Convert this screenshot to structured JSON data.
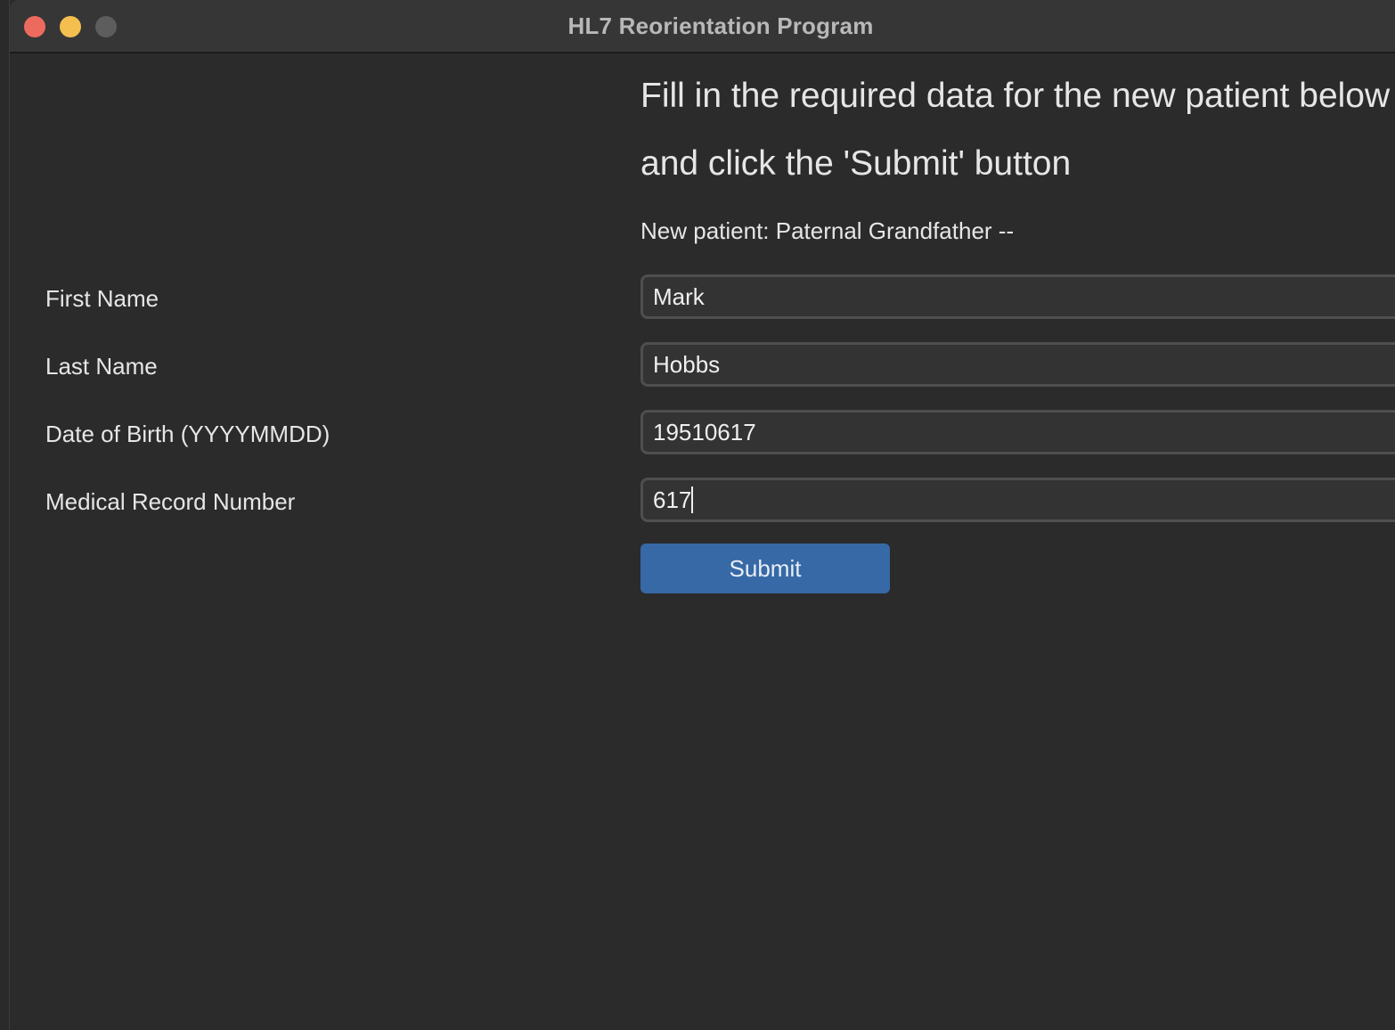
{
  "window": {
    "title": "HL7 Reorientation Program"
  },
  "instructions": {
    "line1": "Fill in the required data for the new patient below",
    "line2": "and click the 'Submit' button"
  },
  "patient": {
    "subtitle": "New patient: Paternal Grandfather --"
  },
  "form": {
    "first_name": {
      "label": "First Name",
      "value": "Mark"
    },
    "last_name": {
      "label": "Last Name",
      "value": "Hobbs"
    },
    "dob": {
      "label": "Date of Birth (YYYYMMDD)",
      "value": "19510617"
    },
    "mrn": {
      "label": "Medical Record Number",
      "value": "617"
    }
  },
  "buttons": {
    "submit_label": "Submit"
  },
  "colors": {
    "close": "#ed6a5e",
    "minimize": "#f5bf4f",
    "maximize": "#5d5d5e",
    "accent": "#3669a6",
    "background": "#2b2b2b"
  }
}
